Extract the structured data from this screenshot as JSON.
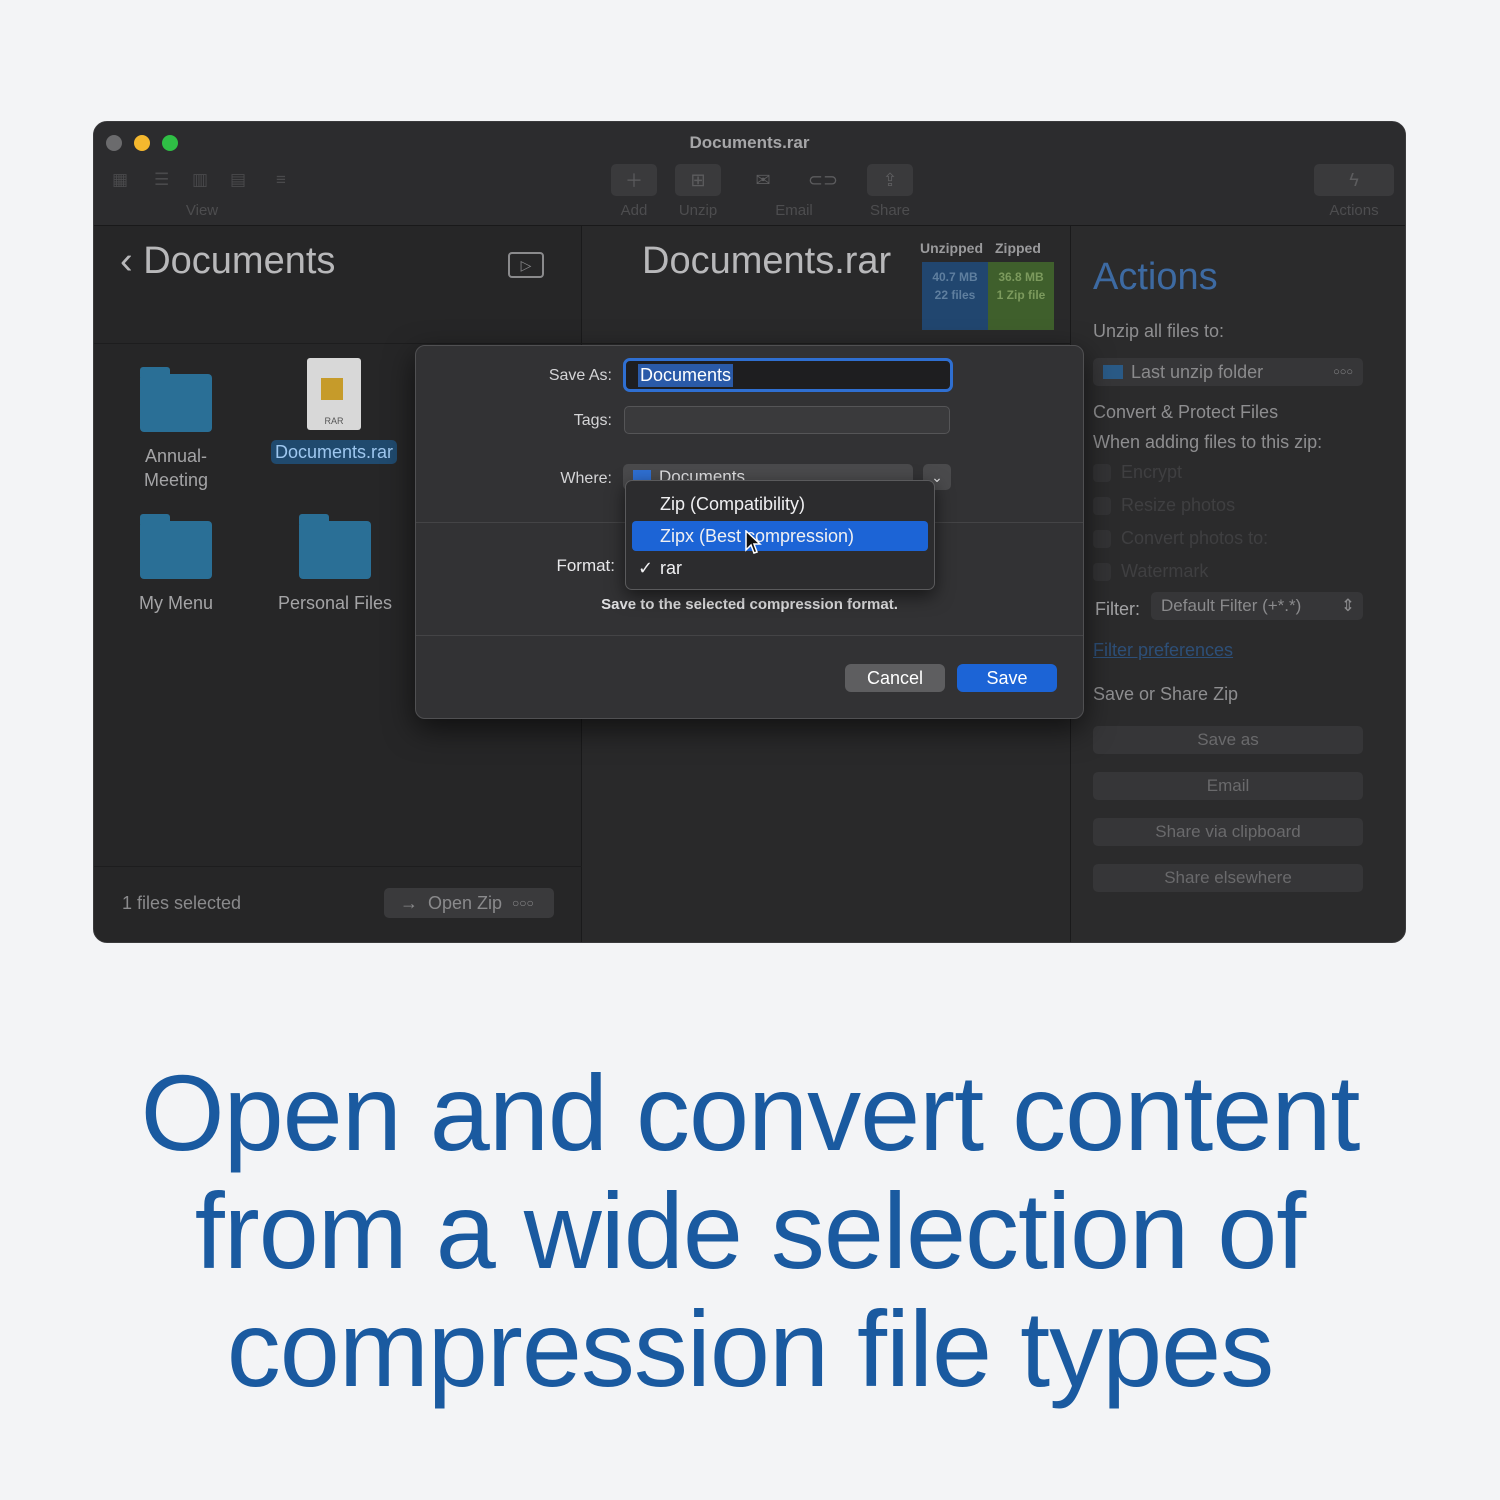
{
  "window": {
    "title": "Documents.rar",
    "colors": {
      "close": "#6b6b6d",
      "minimize": "#f5b82e",
      "zoom": "#2fbf45"
    }
  },
  "toolbar": {
    "view_label": "View",
    "add_label": "Add",
    "unzip_label": "Unzip",
    "email_label": "Email",
    "share_label": "Share",
    "actions_label": "Actions"
  },
  "left_pane": {
    "back_title": "Documents",
    "files": [
      {
        "label": "Annual-\nMeeting"
      },
      {
        "label": "Documents.rar"
      },
      {
        "label": "My Menu"
      },
      {
        "label": "Personal Files"
      }
    ],
    "rar_icon_text": "RAR",
    "files_selected": "1 files selected",
    "open_zip_label": "Open Zip"
  },
  "middle_pane": {
    "archive_title": "Documents.rar",
    "unzipped_head": "Unzipped",
    "zipped_head": "Zipped",
    "unzipped_size": "40.7 MB",
    "unzipped_count": "22 files",
    "zipped_size": "36.8 MB",
    "zipped_count": "1 Zip file"
  },
  "actions_pane": {
    "title": "Actions",
    "unzip_all_label": "Unzip all files to:",
    "unzip_dest": "Last unzip folder",
    "convert_title": "Convert & Protect Files",
    "convert_sub": "When adding files to this zip:",
    "options": [
      "Encrypt",
      "Resize photos",
      "Convert photos to:",
      "Watermark"
    ],
    "filter_label": "Filter:",
    "filter_value": "Default Filter (+*.*)",
    "filter_prefs": "Filter preferences",
    "save_share_title": "Save or Share Zip",
    "buttons": [
      "Save as",
      "Email",
      "Share via clipboard",
      "Share elsewhere"
    ]
  },
  "dialog": {
    "save_as_label": "Save As:",
    "save_as_value": "Documents",
    "tags_label": "Tags:",
    "where_label": "Where:",
    "where_value": "Documents",
    "format_label": "Format:",
    "hint": "Save to the selected compression format.",
    "cancel_label": "Cancel",
    "save_label": "Save"
  },
  "format_menu": {
    "items": [
      "Zip (Compatibility)",
      "Zipx (Best compression)",
      "rar"
    ],
    "highlighted_index": 1,
    "checked_index": 2,
    "check_glyph": "✓"
  },
  "caption": {
    "line1": "Open and convert content",
    "line2": "from a wide selection of",
    "line3": "compression file types"
  },
  "colors": {
    "accent": "#1c64d6",
    "caption": "#1a5aa0"
  }
}
